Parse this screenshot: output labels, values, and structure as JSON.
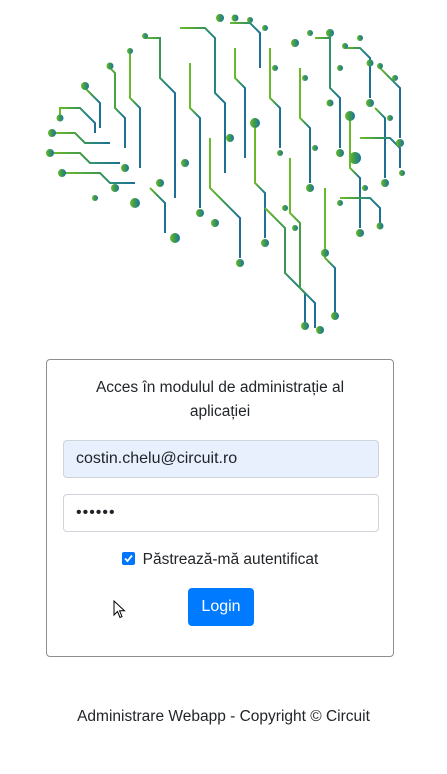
{
  "login": {
    "title": "Acces în modulul de administrație al aplicației",
    "email_value": "costin.chelu@circuit.ro",
    "password_value": "••••••",
    "remember_label": "Păstrează-mă autentificat",
    "remember_checked": true,
    "login_label": "Login"
  },
  "footer": {
    "text": "Administrare Webapp - Copyright © Circuit"
  },
  "colors": {
    "primary": "#007bff",
    "logo_green": "#5aab2e",
    "logo_teal": "#1f7f8f",
    "autofill_bg": "#e8f0fe"
  },
  "icons": [
    "circuit-brain-logo",
    "checkbox-checked-icon",
    "mouse-pointer-icon"
  ]
}
